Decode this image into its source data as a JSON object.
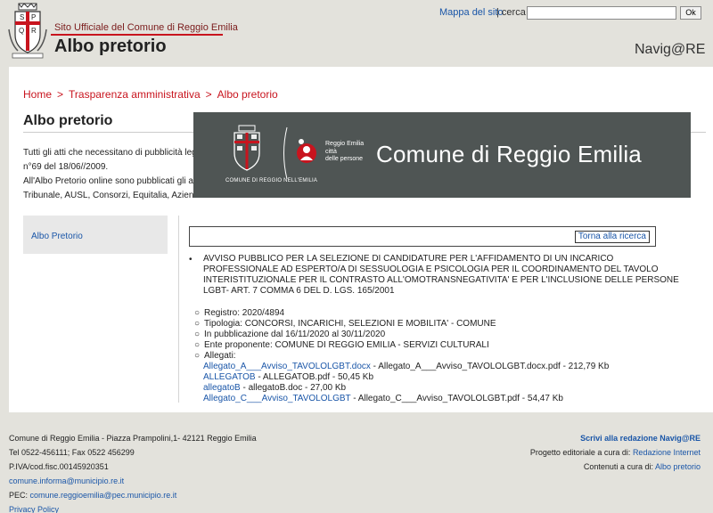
{
  "header": {
    "official_link": "Sito Ufficiale del Comune di Reggio Emilia",
    "site_title": "Albo pretorio",
    "sitemap_link": "Mappa del sito",
    "search_label": " | cerca",
    "search_value": "",
    "ok_button": "Ok",
    "navigare_logo": "Navig@RE",
    "crest_letters": [
      "S",
      "P",
      "Q",
      "R"
    ]
  },
  "breadcrumb": {
    "items": [
      "Home",
      "Trasparenza amministrativa",
      "Albo pretorio"
    ],
    "separator": ">"
  },
  "page_title": "Albo pretorio",
  "intro": {
    "line1": "Tutti gli atti che necessitano di pubblicità lega",
    "line2": "n°69 del 18/06//2009.",
    "line3": "All'Albo Pretorio online sono pubblicati gli att",
    "line4": "Tribunale, AUSL, Consorzi, Equitalia, Aziend"
  },
  "banner": {
    "city_caption": "COMUNE DI REGGIO NELL'EMILIA",
    "sub1": "Reggio Emilia",
    "sub2": "città",
    "sub3": "delle persone",
    "name": "Comune di Reggio Emilia"
  },
  "sidebar": {
    "link": "Albo Pretorio"
  },
  "result": {
    "back_button": "Torna alla ricerca"
  },
  "record": {
    "title": "AVVISO PUBBLICO PER LA SELEZIONE DI CANDIDATURE PER L'AFFIDAMENTO DI UN INCARICO PROFESSIONALE AD ESPERTO/A DI SESSUOLOGIA E PSICOLOGIA PER IL COORDINAMENTO DEL TAVOLO INTERISTITUZIONALE PER IL CONTRASTO ALL'OMOTRANSNEGATIVITA' E PER L'INCLUSIONE DELLE PERSONE LGBT- ART. 7 COMMA 6 DEL D. LGS. 165/2001",
    "registro": "Registro: 2020/4894",
    "tipologia": "Tipologia: CONCORSI, INCARICHI, SELEZIONI E MOBILITA' - COMUNE",
    "pubblicazione": "In pubblicazione dal 16/11/2020 al 30/11/2020",
    "ente": "Ente proponente: COMUNE DI REGGIO EMILIA - SERVIZI CULTURALI",
    "allegati_label": "Allegati:",
    "attachments": [
      {
        "link": "Allegato_A___Avviso_TAVOLOLGBT.docx",
        "info": " - Allegato_A___Avviso_TAVOLOLGBT.docx.pdf - 212,79 Kb"
      },
      {
        "link": "ALLEGATOB",
        "info": " - ALLEGATOB.pdf - 50,45 Kb"
      },
      {
        "link": "allegatoB",
        "info": " - allegatoB.doc - 27,00 Kb"
      },
      {
        "link": "Allegato_C___Avviso_TAVOLOLGBT",
        "info": " - Allegato_C___Avviso_TAVOLOLGBT.pdf - 54,47 Kb"
      }
    ]
  },
  "footer": {
    "address": "Comune di Reggio Emilia - Piazza Prampolini,1- 42121 Reggio Emilia",
    "phone": "Tel 0522-456111; Fax 0522 456299",
    "piva": "P.IVA/cod.fisc.00145920351",
    "email": "comune.informa@municipio.re.it",
    "pec_label": "PEC: ",
    "pec": "comune.reggioemilia@pec.municipio.re.it",
    "privacy": "Privacy Policy",
    "write_link": "Scrivi alla redazione Navig@RE",
    "editorial_label": "Progetto editoriale a cura di: ",
    "editorial_link": "Redazione Internet",
    "contents_label": "Contenuti a cura di: ",
    "contents_link": "Albo pretorio"
  },
  "colors": {
    "brand_red": "#c8141e",
    "link_blue": "#1a56a8",
    "banner_bg": "#4f5554",
    "page_bg": "#e3e2dc"
  }
}
